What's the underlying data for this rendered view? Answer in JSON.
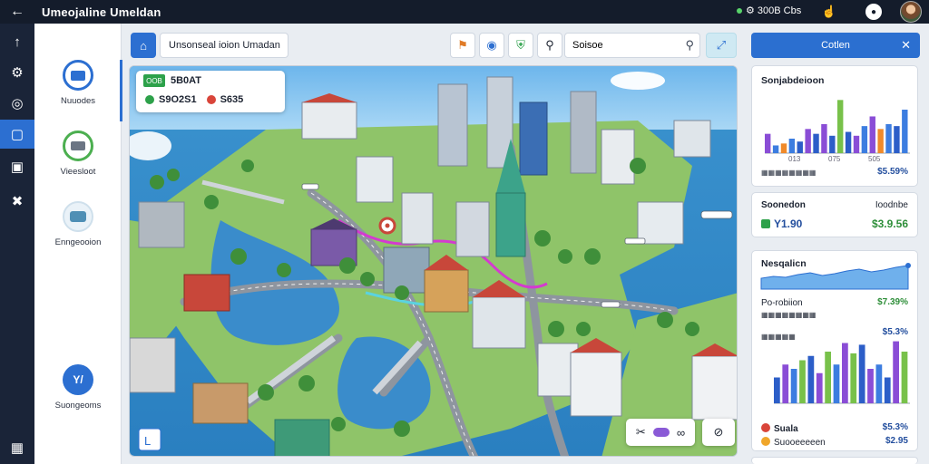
{
  "app": {
    "title": "Umeojaline Umeldan"
  },
  "topbar": {
    "status_text": "⚙ 300B Cbs",
    "status_color": "#58d36a"
  },
  "rail": {
    "items": [
      {
        "icon": "arrow-up-icon",
        "glyph": "↑"
      },
      {
        "icon": "gear-icon",
        "glyph": "⚙"
      },
      {
        "icon": "target-icon",
        "glyph": "◎"
      },
      {
        "icon": "square-icon",
        "glyph": "▢"
      },
      {
        "icon": "image-icon",
        "glyph": "▣"
      },
      {
        "icon": "pin-icon",
        "glyph": "✖"
      },
      {
        "icon": "building-icon",
        "glyph": "▦"
      }
    ],
    "active_index": 3
  },
  "sidenav": {
    "items": [
      {
        "label": "Nuuodes",
        "icon": "monitor-icon",
        "color": "#2c6fd1"
      },
      {
        "label": "Vieesloot",
        "icon": "ring-icon",
        "color": "#4caf50"
      },
      {
        "label": "Enngeooion",
        "icon": "bus-icon",
        "color": "#4f8fb5"
      },
      {
        "label": "Suongeoms",
        "icon": "chart-icon",
        "color": "#2c6fd1",
        "glyph": "Y/"
      }
    ]
  },
  "maptools": {
    "crumb": "Unsonseal ioion Umadan",
    "search_value": "Soisoe",
    "buttons": [
      "layers-icon",
      "globe-icon",
      "shield-icon",
      "pin-icon"
    ]
  },
  "mapcard": {
    "badge": "OOB",
    "title": "5B0AT",
    "value1": "S9O2S1",
    "value2": "S635",
    "value1_color": "#2da14a",
    "value2_color": "#d9453a"
  },
  "map_controls": {
    "left_group": [
      "scissors-icon",
      "toggle-icon",
      "loop-icon"
    ],
    "right_group": [
      "compass-icon"
    ]
  },
  "panel": {
    "header": "Cotlen",
    "card1": {
      "title": "Sonjabdeioon",
      "x_labels": [
        "013",
        "075",
        "505"
      ],
      "footer_left": "▦▦▦▦▦▦▦▦",
      "footer_right": "$5.59%",
      "chart_data": {
        "type": "bar",
        "categories": [
          "1",
          "2",
          "3",
          "4",
          "5",
          "6",
          "7",
          "8",
          "9",
          "10",
          "11",
          "12",
          "13",
          "14",
          "15",
          "16",
          "17",
          "18"
        ],
        "values": [
          20,
          8,
          10,
          15,
          12,
          25,
          20,
          30,
          18,
          55,
          22,
          18,
          28,
          38,
          25,
          30,
          28,
          45
        ],
        "colors": [
          "#8a4dd6",
          "#3c7de0",
          "#f08a2a",
          "#3c7de0",
          "#2c5ec8",
          "#8a4dd6",
          "#2c5ec8",
          "#8a4dd6",
          "#2c5ec8",
          "#78c14a",
          "#2c5ec8",
          "#8a4dd6",
          "#3c7de0",
          "#8a4dd6",
          "#f08a2a",
          "#3c7de0",
          "#2c5ec8",
          "#3c7de0"
        ],
        "ylim": [
          0,
          60
        ]
      }
    },
    "card2": {
      "title": "Soonedon",
      "right_title": "Ioodnbe",
      "value_left": "Y1.90",
      "value_right": "$3.9.56"
    },
    "card3": {
      "title": "Nesqalicn",
      "row1_label": "Po-robiion",
      "row1_value": "$7.39%",
      "row2_label": "▦▦▦▦▦▦▦▦",
      "row2_value": "$5.3%",
      "row3_label": "▦▦▦▦▦",
      "row3_value": "",
      "row4_label": "Suala",
      "row4_value": "$5.3%",
      "row5_label": "Suooeeeeen",
      "row5_value": "$2.95",
      "area_chart": {
        "type": "area",
        "values": [
          12,
          14,
          13,
          16,
          18,
          15,
          17,
          20,
          22,
          19,
          21,
          24,
          26
        ],
        "ylim": [
          0,
          30
        ]
      },
      "chart_data": {
        "type": "bar",
        "categories": [
          "1",
          "2",
          "3",
          "4",
          "5",
          "6",
          "7",
          "8",
          "9",
          "10",
          "11",
          "12",
          "13",
          "14",
          "15",
          "16"
        ],
        "values": [
          30,
          45,
          40,
          50,
          55,
          35,
          60,
          45,
          70,
          58,
          68,
          40,
          45,
          30,
          72,
          60
        ],
        "colors": [
          "#2c5ec8",
          "#8a4dd6",
          "#3c7de0",
          "#78c14a",
          "#2c5ec8",
          "#8a4dd6",
          "#78c14a",
          "#3c7de0",
          "#8a4dd6",
          "#78c14a",
          "#2c5ec8",
          "#8a4dd6",
          "#3c7de0",
          "#2c5ec8",
          "#8a4dd6",
          "#78c14a"
        ],
        "ylim": [
          0,
          80
        ]
      }
    }
  }
}
